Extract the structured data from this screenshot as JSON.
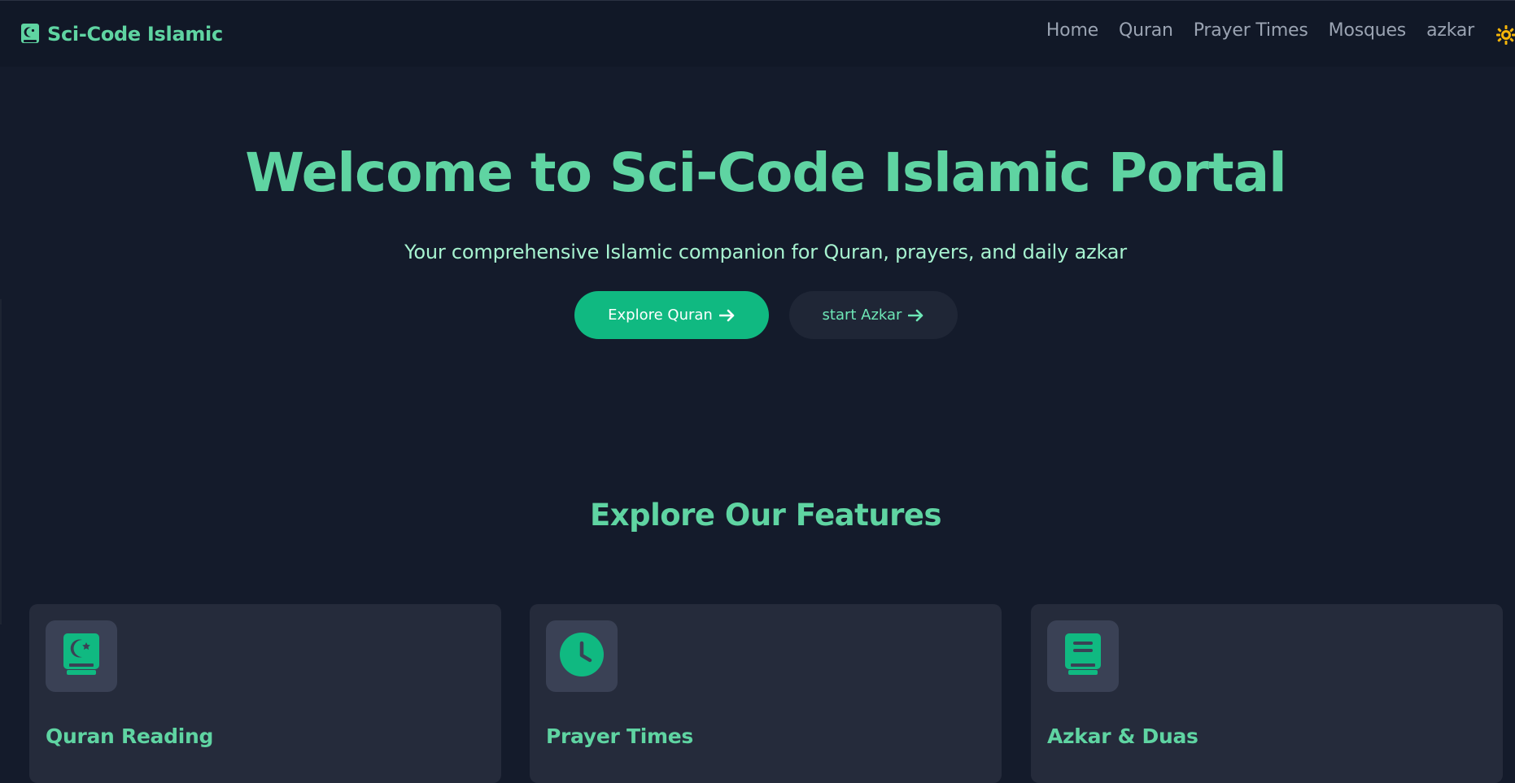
{
  "brand": {
    "name": "Sci-Code Islamic"
  },
  "nav": {
    "links": [
      "Home",
      "Quran",
      "Prayer Times",
      "Mosques",
      "azkar"
    ]
  },
  "hero": {
    "title": "Welcome to Sci-Code Islamic Portal",
    "subtitle": "Your comprehensive Islamic companion for Quran, prayers, and daily azkar",
    "primary_button": "Explore Quran",
    "secondary_button": "start Azkar"
  },
  "features": {
    "title": "Explore Our Features",
    "cards": [
      {
        "title": "Quran Reading",
        "icon": "quran-book-icon"
      },
      {
        "title": "Prayer Times",
        "icon": "clock-icon"
      },
      {
        "title": "Azkar & Duas",
        "icon": "book-icon"
      }
    ]
  },
  "colors": {
    "background": "#141b2b",
    "navbar": "#111827",
    "accent": "#5fd4a2",
    "primary_button": "#10b981",
    "card": "#252b3b",
    "icon_box": "#3a4155",
    "theme_toggle": "#f5b50a"
  }
}
